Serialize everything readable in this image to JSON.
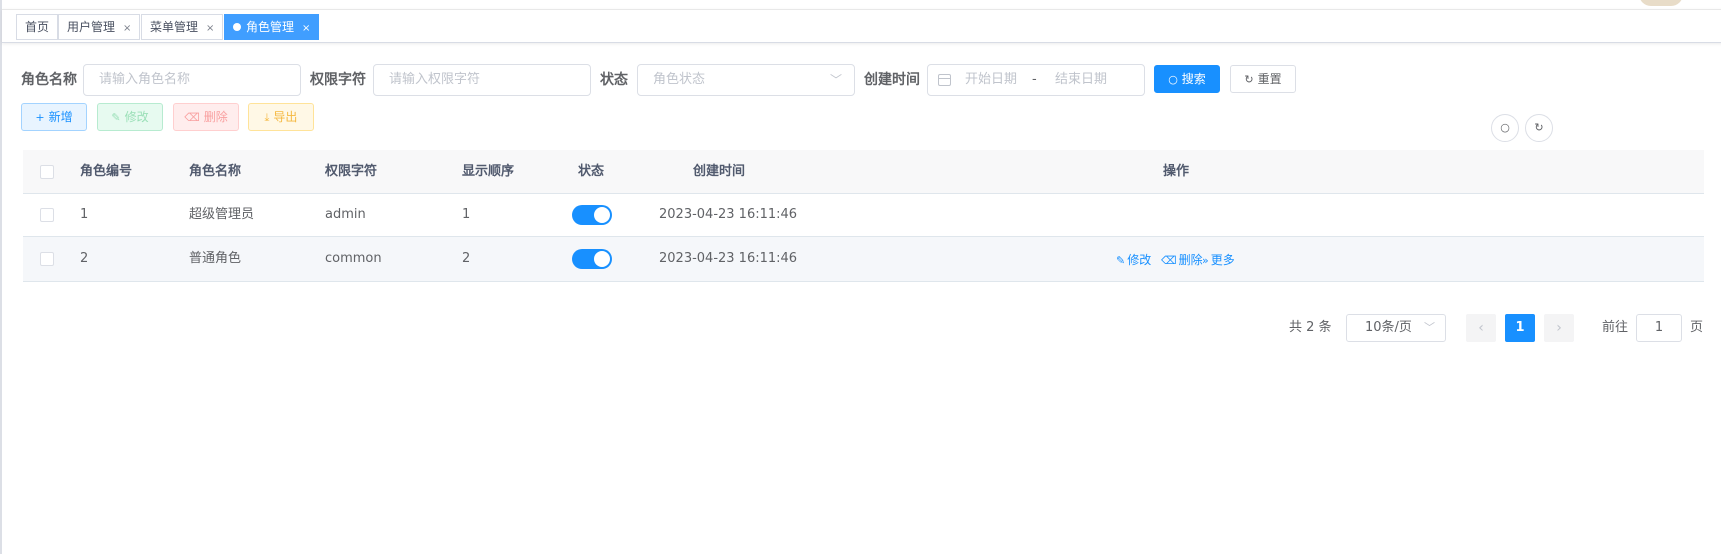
{
  "tags": [
    {
      "label": "首页",
      "closable": false,
      "active": false
    },
    {
      "label": "用户管理",
      "closable": true,
      "active": false
    },
    {
      "label": "菜单管理",
      "closable": true,
      "active": false
    },
    {
      "label": "角色管理",
      "closable": true,
      "active": true
    }
  ],
  "tag_close_glyph": "×",
  "search": {
    "role_name_label": "角色名称",
    "role_name_placeholder": "请输入角色名称",
    "role_key_label": "权限字符",
    "role_key_placeholder": "请输入权限字符",
    "status_label": "状态",
    "status_placeholder": "角色状态",
    "created_label": "创建时间",
    "start_placeholder": "开始日期",
    "range_separator": "-",
    "end_placeholder": "结束日期",
    "search_button": "搜索",
    "reset_button": "重置"
  },
  "toolbar": {
    "add": "新增",
    "edit": "修改",
    "delete": "删除",
    "export": "导出"
  },
  "table": {
    "headers": [
      "角色编号",
      "角色名称",
      "权限字符",
      "显示顺序",
      "状态",
      "创建时间",
      "操作"
    ],
    "rows": [
      {
        "id": "1",
        "name": "超级管理员",
        "key": "admin",
        "sort": "1",
        "enabled": true,
        "created": "2023-04-23 16:11:46",
        "actions": []
      },
      {
        "id": "2",
        "name": "普通角色",
        "key": "common",
        "sort": "2",
        "enabled": true,
        "created": "2023-04-23 16:11:46",
        "actions": [
          "修改",
          "删除",
          "更多"
        ]
      }
    ]
  },
  "pagination": {
    "total_text": "共 2 条",
    "page_size": "10条/页",
    "current_page": "1",
    "goto_label": "前往",
    "goto_value": "1",
    "page_unit": "页"
  },
  "colors": {
    "primary": "#1890ff",
    "active_tag": "#409eff"
  }
}
